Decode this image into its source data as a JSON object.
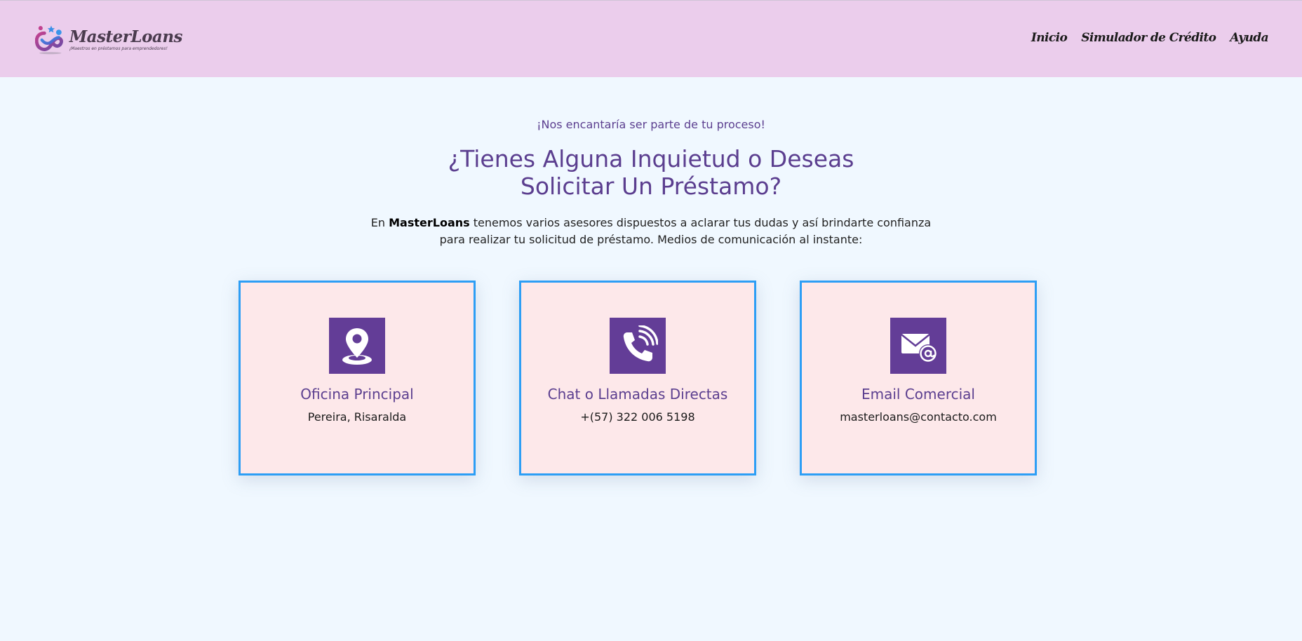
{
  "header": {
    "brand": "MasterLoans",
    "tagline": "¡Maestros en préstamos para emprendedores!",
    "nav": [
      "Inicio",
      "Simulador de Crédito",
      "Ayuda"
    ]
  },
  "hero": {
    "eyebrow": "¡Nos encantaría ser parte de tu proceso!",
    "title_line1": "¿Tienes Alguna Inquietud o Deseas",
    "title_line2": "Solicitar Un Préstamo?",
    "intro_prefix": "En ",
    "intro_brand": "MasterLoans",
    "intro_rest": " tenemos varios asesores dispuestos a aclarar tus dudas y así brindarte confianza para realizar tu solicitud de préstamo. Medios de comunicación al instante:"
  },
  "cards": [
    {
      "icon": "location-pin-icon",
      "title": "Oficina Principal",
      "text": "Pereira, Risaralda"
    },
    {
      "icon": "phone-call-icon",
      "title": "Chat o Llamadas Directas",
      "text": "+(57) 322 006 5198"
    },
    {
      "icon": "email-at-icon",
      "title": "Email Comercial",
      "text": "masterloans@contacto.com"
    }
  ],
  "colors": {
    "header_bg": "#ebcdec",
    "page_bg": "#f0f8ff",
    "accent_purple": "#633d97",
    "heading_purple": "#5b3e8f",
    "card_bg": "#fde8ea",
    "card_border": "#2d9ef5"
  }
}
